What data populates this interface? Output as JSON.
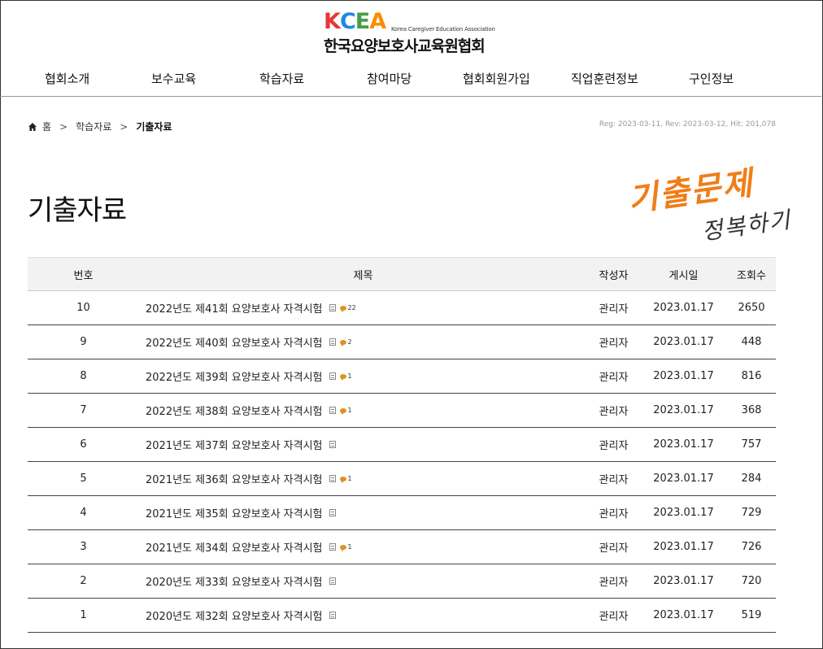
{
  "header": {
    "logo_mark": [
      "K",
      "C",
      "E",
      "A"
    ],
    "logo_colors": [
      "#e53935",
      "#1e88e5",
      "#43a047",
      "#fb8c00"
    ],
    "logo_english": "Korea Caregiver Education Association",
    "logo_korean": "한국요양보호사교육원협회"
  },
  "nav": {
    "items": [
      "협회소개",
      "보수교육",
      "학습자료",
      "참여마당",
      "협회회원가입",
      "직업훈련정보",
      "구인정보"
    ]
  },
  "breadcrumb": {
    "home": "홈",
    "section": "학습자료",
    "current": "기출자료",
    "separator": ">"
  },
  "meta": "Reg: 2023-03-11, Rev: 2023-03-12, Hit: 201,078",
  "page_title": "기출자료",
  "promo": {
    "line1": "기출문제",
    "line2": "정복하기",
    "line1_color": "#f07d18"
  },
  "board": {
    "columns": [
      "번호",
      "제목",
      "작성자",
      "게시일",
      "조회수"
    ],
    "rows": [
      {
        "num": "10",
        "title": "2022년도 제41회 요양보호사 자격시험",
        "comments": "22",
        "writer": "관리자",
        "date": "2023.01.17",
        "views": "2650"
      },
      {
        "num": "9",
        "title": "2022년도 제40회 요양보호사 자격시험",
        "comments": "2",
        "writer": "관리자",
        "date": "2023.01.17",
        "views": "448"
      },
      {
        "num": "8",
        "title": "2022년도 제39회 요양보호사 자격시험",
        "comments": "1",
        "writer": "관리자",
        "date": "2023.01.17",
        "views": "816"
      },
      {
        "num": "7",
        "title": "2022년도 제38회 요양보호사 자격시험",
        "comments": "1",
        "writer": "관리자",
        "date": "2023.01.17",
        "views": "368"
      },
      {
        "num": "6",
        "title": "2021년도 제37회 요양보호사 자격시험",
        "comments": "",
        "writer": "관리자",
        "date": "2023.01.17",
        "views": "757"
      },
      {
        "num": "5",
        "title": "2021년도 제36회 요양보호사 자격시험",
        "comments": "1",
        "writer": "관리자",
        "date": "2023.01.17",
        "views": "284"
      },
      {
        "num": "4",
        "title": "2021년도 제35회 요양보호사 자격시험",
        "comments": "",
        "writer": "관리자",
        "date": "2023.01.17",
        "views": "729"
      },
      {
        "num": "3",
        "title": "2021년도 제34회 요양보호사 자격시험",
        "comments": "1",
        "writer": "관리자",
        "date": "2023.01.17",
        "views": "726"
      },
      {
        "num": "2",
        "title": "2020년도 제33회 요양보호사 자격시험",
        "comments": "",
        "writer": "관리자",
        "date": "2023.01.17",
        "views": "720"
      },
      {
        "num": "1",
        "title": "2020년도 제32회 요양보호사 자격시험",
        "comments": "",
        "writer": "관리자",
        "date": "2023.01.17",
        "views": "519"
      }
    ]
  }
}
